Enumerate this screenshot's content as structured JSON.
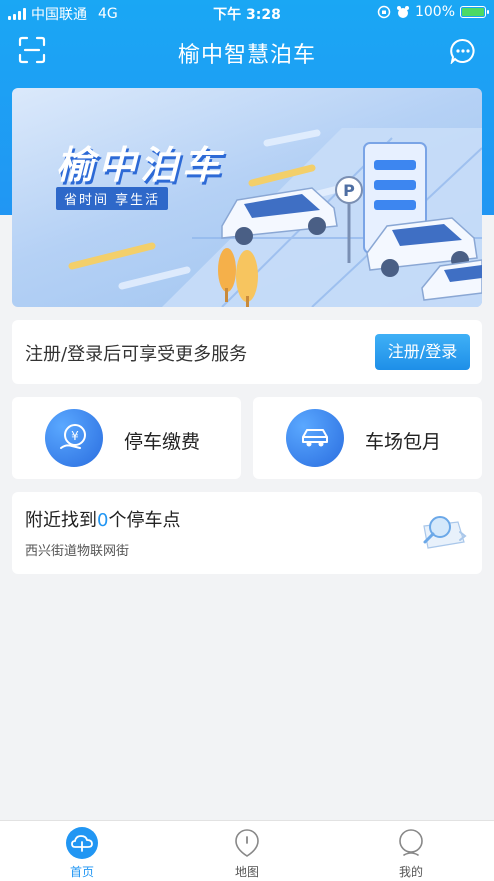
{
  "status_bar": {
    "carrier": "中国联通",
    "network": "4G",
    "time": "下午 3:28",
    "battery": "100%"
  },
  "nav": {
    "title": "榆中智慧泊车"
  },
  "banner": {
    "title": "榆中泊车",
    "subtitle": "省时间 享生活",
    "parking_sign": "P"
  },
  "login": {
    "prompt": "注册/登录后可享受更多服务",
    "button_label": "注册/登录"
  },
  "services": [
    {
      "label": "停车缴费",
      "icon": "yen-payment-icon"
    },
    {
      "label": "车场包月",
      "icon": "car-icon"
    }
  ],
  "nearby": {
    "prefix": "附近找到",
    "count": "0",
    "suffix": "个停车点",
    "street": "西兴街道物联网街",
    "icon": "map-search-icon"
  },
  "tabbar": [
    {
      "label": "首页",
      "icon": "home-cloud-icon",
      "active": true
    },
    {
      "label": "地图",
      "icon": "map-pin-icon",
      "active": false
    },
    {
      "label": "我的",
      "icon": "profile-icon",
      "active": false
    }
  ],
  "colors": {
    "accent": "#2196f3",
    "background": "#f2f3f5",
    "banner_text_shadow": "#2d6ad6"
  }
}
